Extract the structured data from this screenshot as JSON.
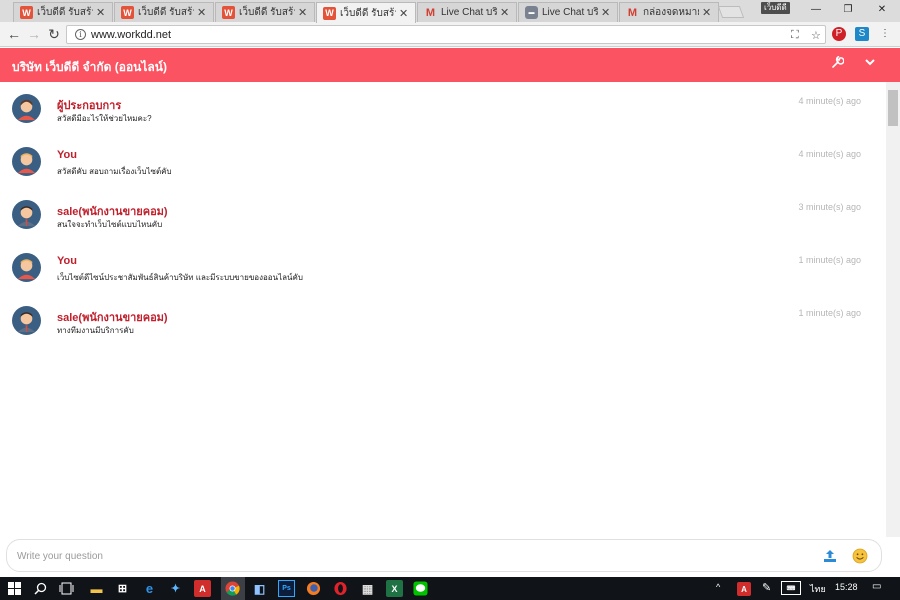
{
  "browser": {
    "tabs": [
      {
        "title": "เว็บดีดี รับสร้าง",
        "icon": "workdd-favicon-icon",
        "active": false
      },
      {
        "title": "เว็บดีดี รับสร้าง",
        "icon": "workdd-favicon-icon",
        "active": false
      },
      {
        "title": "เว็บดีดี รับสร้าง",
        "icon": "workdd-favicon-icon",
        "active": false
      },
      {
        "title": "เว็บดีดี รับสร้าง",
        "icon": "workdd-favicon-icon",
        "active": true
      },
      {
        "title": "Live Chat บริษั",
        "icon": "gmail-icon",
        "active": false
      },
      {
        "title": "Live Chat บริษั",
        "icon": "site-favicon-icon",
        "active": false
      },
      {
        "title": "กล่องจดหมาย (",
        "icon": "gmail-icon",
        "active": false
      }
    ],
    "profile_label": "เว็บดีดี",
    "url": "www.workdd.net"
  },
  "chat": {
    "title": "บริษัท เว็บดีดี จำกัด (ออนไลน์)",
    "messages": [
      {
        "name": "ผู้ประกอบการ",
        "text": "สวัสดีมีอะไรให้ช่วยไหมคะ?",
        "time": "4 minute(s) ago",
        "avatar": "female-avatar"
      },
      {
        "name": "You",
        "text": "สวัสดีคับ สอบถามเรื่องเว็บไซต์คับ",
        "time": "4 minute(s) ago",
        "avatar": "user-avatar"
      },
      {
        "name": "sale(พนักงานขายคอม)",
        "text": "สนใจจะทำเว็บไซต์แบบไหนคับ",
        "time": "3 minute(s) ago",
        "avatar": "agent-avatar"
      },
      {
        "name": "You",
        "text": "เว็บไซต์ดีไซน์ประชาสัมพันธ์สินค้าบริษัท และมีระบบขายของออนไลน์คับ",
        "time": "1 minute(s) ago",
        "avatar": "user-avatar"
      },
      {
        "name": "sale(พนักงานขายคอม)",
        "text": "ทางทีมงานมีบริการคับ",
        "time": "1 minute(s) ago",
        "avatar": "agent-avatar"
      }
    ],
    "input_placeholder": "Write your question"
  },
  "taskbar": {
    "language": "ไทย",
    "time": "15:28"
  },
  "colors": {
    "header_bg": "#fb5361",
    "name_color": "#c0202c",
    "timestamp_color": "#b6b6b6",
    "taskbar_bg": "#101318"
  }
}
